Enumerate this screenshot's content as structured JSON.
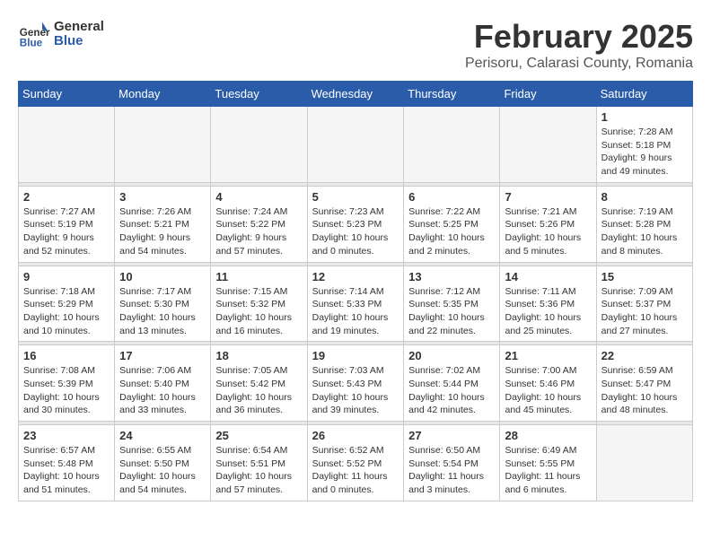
{
  "header": {
    "logo_general": "General",
    "logo_blue": "Blue",
    "month_title": "February 2025",
    "location": "Perisoru, Calarasi County, Romania"
  },
  "weekdays": [
    "Sunday",
    "Monday",
    "Tuesday",
    "Wednesday",
    "Thursday",
    "Friday",
    "Saturday"
  ],
  "weeks": [
    [
      {
        "day": "",
        "info": ""
      },
      {
        "day": "",
        "info": ""
      },
      {
        "day": "",
        "info": ""
      },
      {
        "day": "",
        "info": ""
      },
      {
        "day": "",
        "info": ""
      },
      {
        "day": "",
        "info": ""
      },
      {
        "day": "1",
        "info": "Sunrise: 7:28 AM\nSunset: 5:18 PM\nDaylight: 9 hours and 49 minutes."
      }
    ],
    [
      {
        "day": "2",
        "info": "Sunrise: 7:27 AM\nSunset: 5:19 PM\nDaylight: 9 hours and 52 minutes."
      },
      {
        "day": "3",
        "info": "Sunrise: 7:26 AM\nSunset: 5:21 PM\nDaylight: 9 hours and 54 minutes."
      },
      {
        "day": "4",
        "info": "Sunrise: 7:24 AM\nSunset: 5:22 PM\nDaylight: 9 hours and 57 minutes."
      },
      {
        "day": "5",
        "info": "Sunrise: 7:23 AM\nSunset: 5:23 PM\nDaylight: 10 hours and 0 minutes."
      },
      {
        "day": "6",
        "info": "Sunrise: 7:22 AM\nSunset: 5:25 PM\nDaylight: 10 hours and 2 minutes."
      },
      {
        "day": "7",
        "info": "Sunrise: 7:21 AM\nSunset: 5:26 PM\nDaylight: 10 hours and 5 minutes."
      },
      {
        "day": "8",
        "info": "Sunrise: 7:19 AM\nSunset: 5:28 PM\nDaylight: 10 hours and 8 minutes."
      }
    ],
    [
      {
        "day": "9",
        "info": "Sunrise: 7:18 AM\nSunset: 5:29 PM\nDaylight: 10 hours and 10 minutes."
      },
      {
        "day": "10",
        "info": "Sunrise: 7:17 AM\nSunset: 5:30 PM\nDaylight: 10 hours and 13 minutes."
      },
      {
        "day": "11",
        "info": "Sunrise: 7:15 AM\nSunset: 5:32 PM\nDaylight: 10 hours and 16 minutes."
      },
      {
        "day": "12",
        "info": "Sunrise: 7:14 AM\nSunset: 5:33 PM\nDaylight: 10 hours and 19 minutes."
      },
      {
        "day": "13",
        "info": "Sunrise: 7:12 AM\nSunset: 5:35 PM\nDaylight: 10 hours and 22 minutes."
      },
      {
        "day": "14",
        "info": "Sunrise: 7:11 AM\nSunset: 5:36 PM\nDaylight: 10 hours and 25 minutes."
      },
      {
        "day": "15",
        "info": "Sunrise: 7:09 AM\nSunset: 5:37 PM\nDaylight: 10 hours and 27 minutes."
      }
    ],
    [
      {
        "day": "16",
        "info": "Sunrise: 7:08 AM\nSunset: 5:39 PM\nDaylight: 10 hours and 30 minutes."
      },
      {
        "day": "17",
        "info": "Sunrise: 7:06 AM\nSunset: 5:40 PM\nDaylight: 10 hours and 33 minutes."
      },
      {
        "day": "18",
        "info": "Sunrise: 7:05 AM\nSunset: 5:42 PM\nDaylight: 10 hours and 36 minutes."
      },
      {
        "day": "19",
        "info": "Sunrise: 7:03 AM\nSunset: 5:43 PM\nDaylight: 10 hours and 39 minutes."
      },
      {
        "day": "20",
        "info": "Sunrise: 7:02 AM\nSunset: 5:44 PM\nDaylight: 10 hours and 42 minutes."
      },
      {
        "day": "21",
        "info": "Sunrise: 7:00 AM\nSunset: 5:46 PM\nDaylight: 10 hours and 45 minutes."
      },
      {
        "day": "22",
        "info": "Sunrise: 6:59 AM\nSunset: 5:47 PM\nDaylight: 10 hours and 48 minutes."
      }
    ],
    [
      {
        "day": "23",
        "info": "Sunrise: 6:57 AM\nSunset: 5:48 PM\nDaylight: 10 hours and 51 minutes."
      },
      {
        "day": "24",
        "info": "Sunrise: 6:55 AM\nSunset: 5:50 PM\nDaylight: 10 hours and 54 minutes."
      },
      {
        "day": "25",
        "info": "Sunrise: 6:54 AM\nSunset: 5:51 PM\nDaylight: 10 hours and 57 minutes."
      },
      {
        "day": "26",
        "info": "Sunrise: 6:52 AM\nSunset: 5:52 PM\nDaylight: 11 hours and 0 minutes."
      },
      {
        "day": "27",
        "info": "Sunrise: 6:50 AM\nSunset: 5:54 PM\nDaylight: 11 hours and 3 minutes."
      },
      {
        "day": "28",
        "info": "Sunrise: 6:49 AM\nSunset: 5:55 PM\nDaylight: 11 hours and 6 minutes."
      },
      {
        "day": "",
        "info": ""
      }
    ]
  ]
}
